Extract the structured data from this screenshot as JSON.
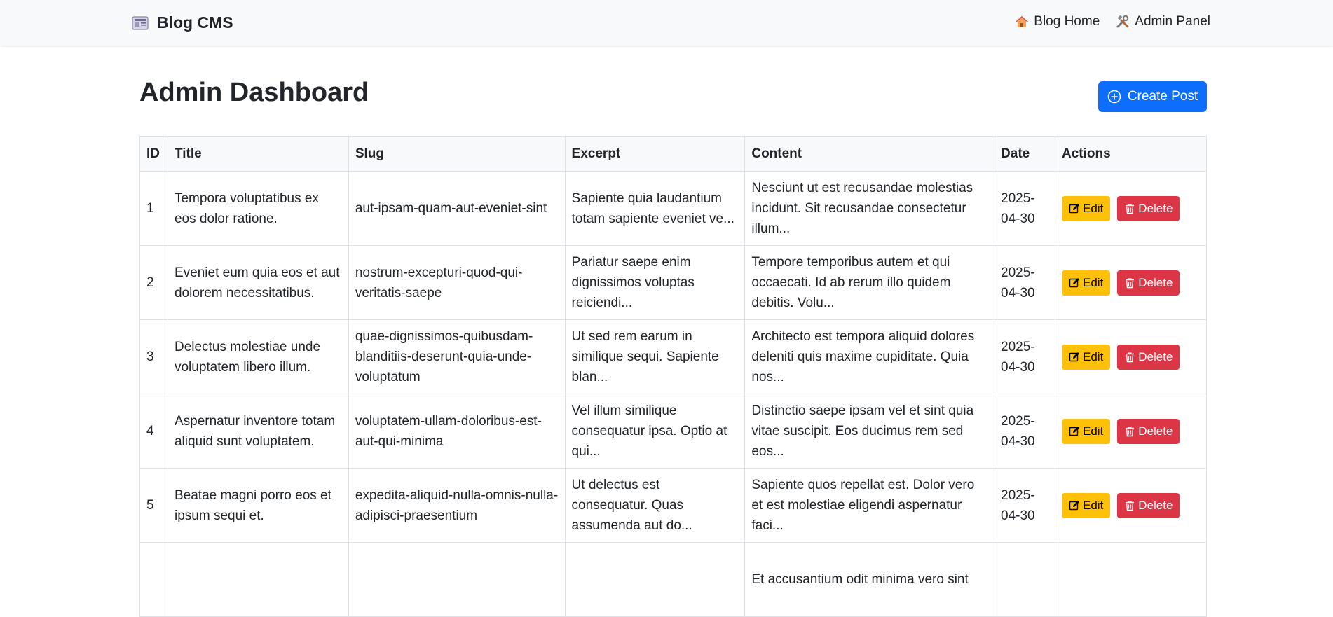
{
  "navbar": {
    "brand": "Blog CMS",
    "links": [
      {
        "label": "Blog Home",
        "icon": "house-icon"
      },
      {
        "label": "Admin Panel",
        "icon": "tools-icon"
      }
    ]
  },
  "page": {
    "title": "Admin Dashboard",
    "create_button": "Create Post"
  },
  "table": {
    "headers": [
      "ID",
      "Title",
      "Slug",
      "Excerpt",
      "Content",
      "Date",
      "Actions"
    ],
    "rows": [
      {
        "id": "1",
        "title": "Tempora voluptatibus ex eos dolor ratione.",
        "slug": "aut-ipsam-quam-aut-eveniet-sint",
        "excerpt": "Sapiente quia laudantium totam sapiente eveniet ve...",
        "content": "Nesciunt ut est recusandae molestias incidunt. Sit recusandae consectetur illum...",
        "date": "2025-04-30"
      },
      {
        "id": "2",
        "title": "Eveniet eum quia eos et aut dolorem necessitatibus.",
        "slug": "nostrum-excepturi-quod-qui-veritatis-saepe",
        "excerpt": "Pariatur saepe enim dignissimos voluptas reiciendi...",
        "content": "Tempore temporibus autem et qui occaecati. Id ab rerum illo quidem debitis. Volu...",
        "date": "2025-04-30"
      },
      {
        "id": "3",
        "title": "Delectus molestiae unde voluptatem libero illum.",
        "slug": "quae-dignissimos-quibusdam-blanditiis-deserunt-quia-unde-voluptatum",
        "excerpt": "Ut sed rem earum in similique sequi. Sapiente blan...",
        "content": "Architecto est tempora aliquid dolores deleniti quis maxime cupiditate. Quia nos...",
        "date": "2025-04-30"
      },
      {
        "id": "4",
        "title": "Aspernatur inventore totam aliquid sunt voluptatem.",
        "slug": "voluptatem-ullam-doloribus-est-aut-qui-minima",
        "excerpt": "Vel illum similique consequatur ipsa. Optio at qui...",
        "content": "Distinctio saepe ipsam vel et sint quia vitae suscipit. Eos ducimus rem sed eos...",
        "date": "2025-04-30"
      },
      {
        "id": "5",
        "title": "Beatae magni porro eos et ipsum sequi et.",
        "slug": "expedita-aliquid-nulla-omnis-nulla-adipisci-praesentium",
        "excerpt": "Ut delectus est consequatur. Quas assumenda aut do...",
        "content": "Sapiente quos repellat est. Dolor vero et est molestiae eligendi aspernatur faci...",
        "date": "2025-04-30"
      },
      {
        "id": "",
        "title": "",
        "slug": "",
        "excerpt": "",
        "content": "Et accusantium odit minima vero sint",
        "date": ""
      }
    ],
    "edit_label": "Edit",
    "delete_label": "Delete"
  },
  "colors": {
    "primary": "#0d6efd",
    "warning": "#ffc107",
    "danger": "#dc3545",
    "navbar_bg": "#f8f9fa"
  }
}
